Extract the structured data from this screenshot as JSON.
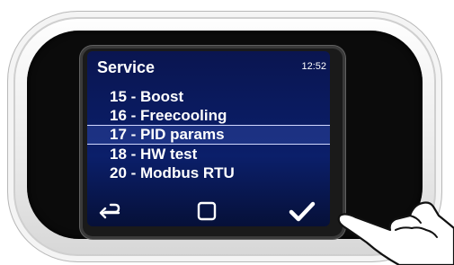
{
  "screen": {
    "title": "Service",
    "clock": "12:52"
  },
  "menu": {
    "items": [
      {
        "label": "15 - Boost",
        "selected": false
      },
      {
        "label": "16 - Freecooling",
        "selected": false
      },
      {
        "label": "17 - PID params",
        "selected": true
      },
      {
        "label": "18 - HW test",
        "selected": false
      },
      {
        "label": "20 - Modbus RTU",
        "selected": false
      }
    ]
  },
  "softkeys": {
    "back_icon": "back-arrow-icon",
    "home_icon": "square-icon",
    "ok_icon": "checkmark-icon"
  },
  "colors": {
    "screen_background": "#0a1a5e",
    "text": "#ffffff",
    "selection_line": "#d0d8ff"
  }
}
